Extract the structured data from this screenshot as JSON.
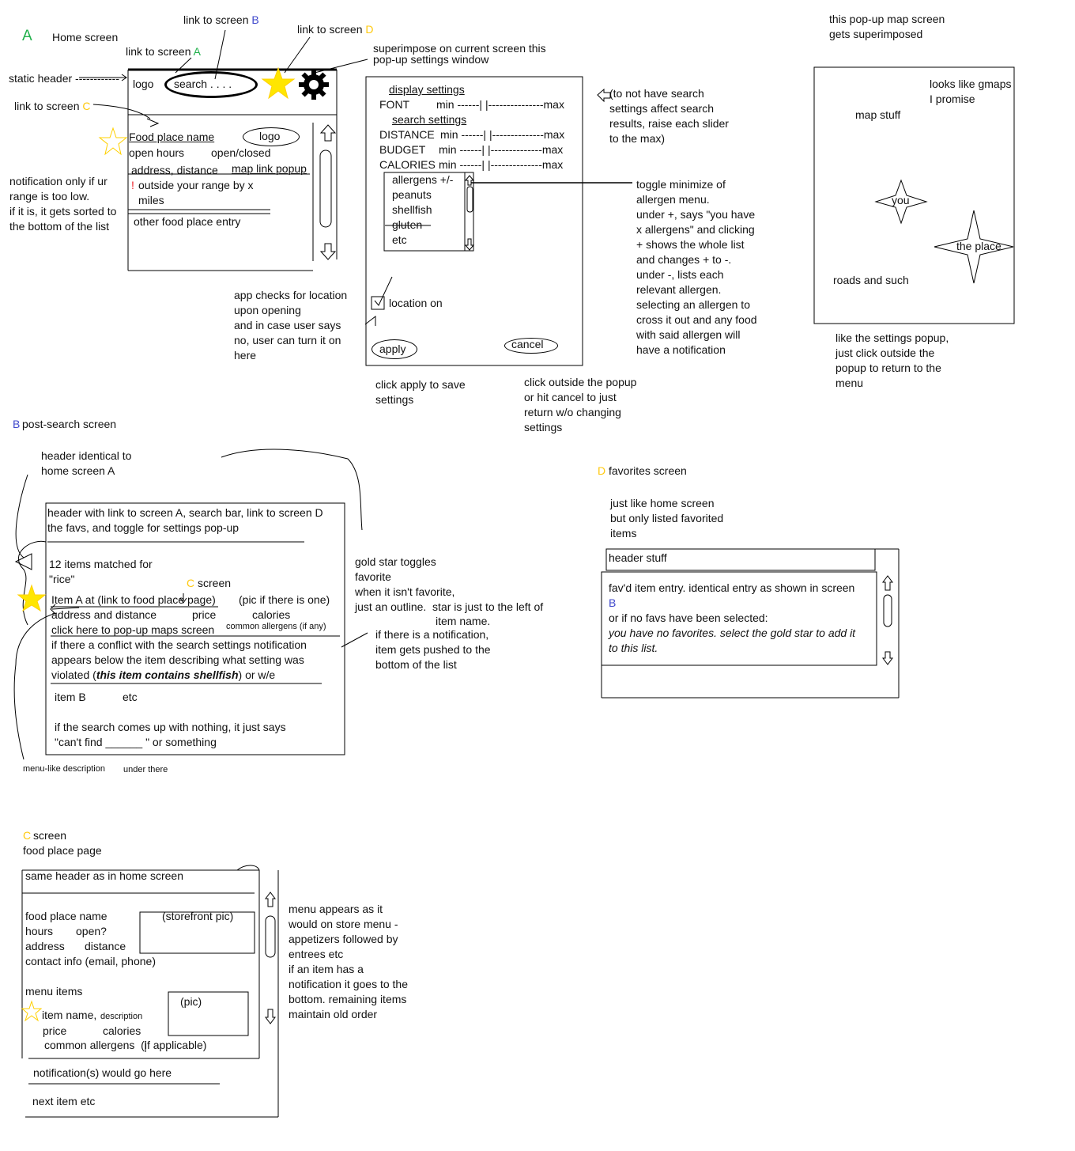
{
  "colors": {
    "green": "#22b14c",
    "blue": "#3f48cc",
    "gold": "#ffc90e",
    "star_fill": "#ffe600",
    "red": "#ed1c24"
  },
  "icons": [
    "star-icon",
    "star-outline-icon",
    "gear-icon",
    "arrow-up-icon",
    "arrow-down-icon",
    "checkbox-icon",
    "compass-star-icon"
  ],
  "home": {
    "letter": "A",
    "title": "Home screen",
    "link_b_prefix": "link to screen ",
    "link_b_letter": "B",
    "link_d_prefix": "link to screen ",
    "link_d_letter": "D",
    "link_a_prefix": "link to screen ",
    "link_a_letter": "A",
    "static_header": "static header ------------",
    "link_c_prefix": "link to screen ",
    "link_c_letter": "C",
    "superimpose": "superimpose on current screen this\npop-up settings window",
    "header_logo": "logo",
    "search": "search . . . .",
    "food_place_name": "Food place name",
    "logo2": "logo",
    "open_hours": "open hours",
    "open_closed": "open/closed",
    "address_distance": "address, distance",
    "map_link": "map link popup",
    "bang": "!",
    "outside_range": "outside your range by x\nmiles",
    "other_entry": "other food place entry",
    "notification_note": "notification only if ur\nrange is too low.\nif it is, it gets sorted to\nthe bottom of the list"
  },
  "settings": {
    "display": "display settings",
    "font": "FONT",
    "search": "search settings",
    "distance": "DISTANCE",
    "budget": "BUDGET",
    "calories": "CALORIES",
    "slider": "min ------| |--------------max",
    "slider_font": "min ------| |---------------max",
    "allergens": [
      "allergens +/-",
      "peanuts",
      "shellfish",
      "gluten",
      "etc"
    ],
    "location": "location on",
    "apply": "apply",
    "cancel": "cancel",
    "note_slider": "(to not have search\nsettings affect search\nresults, raise each slider\nto the max)",
    "note_toggle": "toggle minimize of\nallergen menu.\nunder +, says \"you have\nx allergens\" and clicking\n+ shows the whole list\nand changes + to -.\nunder -, lists each\nrelevant allergen.\nselecting an allergen to\ncross it out and any food\nwith said allergen will\nhave a notification",
    "note_location": "app checks for location\nupon opening\nand in case user says\nno, user can turn it on\nhere",
    "note_apply": "click apply to save\nsettings",
    "note_outside": "click outside the popup\nor hit cancel to just\nreturn w/o changing\nsettings"
  },
  "map": {
    "title": "this pop-up map screen\ngets superimposed",
    "gmaps": "looks like gmaps\nI promise",
    "stuff": "map stuff",
    "you": "you",
    "place": "the place",
    "roads": "roads and such",
    "note": "like the settings popup,\njust click outside the\npopup to return to the\nmenu"
  },
  "postsearch": {
    "letter": "B",
    "title": "post-search screen",
    "header_note": "header identical to\nhome screen A",
    "header_box": "header with link to screen A, search bar, link to screen D\nthe favs, and toggle for settings pop-up",
    "matched": "12 items matched for\n\"rice\"",
    "c_letter": "C",
    "c_screen": "screen",
    "item_a": "Item A at (link to food place page)",
    "pic": "(pic if there is one)",
    "addr": "address and distance",
    "price": "price",
    "calories": "calories",
    "maps": "click here to pop-up maps screen",
    "allergens": "common allergens (if any)",
    "conflict_1": "if there a conflict with the search settings notification\nappears below the item describing what setting was",
    "conflict_2a": "violated (",
    "conflict_2b": "this item contains shellfish",
    "conflict_2c": ") or w/e",
    "item_b": "item B",
    "etc": "etc",
    "nothing": "if the search comes up with nothing, it just says\n\"can't find ______ \" or something",
    "menu_desc": "menu-like description",
    "under": "under there",
    "star_note": "gold star toggles\nfavorite\nwhen it isn't favorite,\njust an outline.  star is just to the left of",
    "star_note2": "item name.",
    "push_note": "if there is a notification,\nitem gets pushed to the\nbottom of the list"
  },
  "favorites": {
    "letter": "D",
    "title": "favorites screen",
    "sub": "just like home screen\nbut only listed favorited\nitems",
    "header": "header stuff",
    "entry": "fav'd item entry. identical entry as shown in screen",
    "b": "B",
    "or": "or if no favs have been selected:",
    "none": "you have no favorites. select the gold star to add it\nto this list."
  },
  "foodplace": {
    "letter": "C",
    "title": "screen",
    "sub": "food place page",
    "header": "same header as in home screen",
    "name": "food place name",
    "storefront": "(storefront pic)",
    "hours": "hours",
    "open": "open?",
    "address": "address",
    "distance": "distance",
    "contact": "contact info (email, phone)",
    "menu_items": "menu items",
    "pic": "(pic)",
    "item_name": "item name,",
    "description": "description",
    "price": "price",
    "calories": "calories",
    "allergens": "common allergens  (if applicable)",
    "notifications": "notification(s) would go here",
    "next": "next item etc",
    "note": "menu appears as it\nwould on store menu -\nappetizers followed by\nentrees etc\nif an item has a\nnotification it goes to the\nbottom. remaining items\nmaintain old order"
  }
}
